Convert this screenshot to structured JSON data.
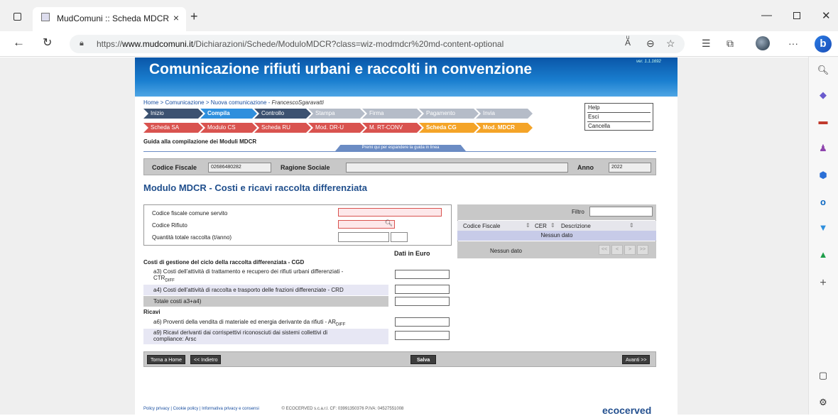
{
  "browser": {
    "tab_title": "MudComuni :: Scheda MDCR",
    "url_prefix": "https://",
    "url_domain": "www.mudcomuni.it",
    "url_path": "/Dichiarazioni/Schede/ModuloMDCR?class=wiz-modmdcr%20md-content-optional"
  },
  "header": {
    "title": "Comunicazione rifiuti urbani e raccolti in convenzione",
    "version": "ver. 1.1.1692"
  },
  "breadcrumb": {
    "path": "Home > Comunicazione > Nuova comunicazione - ",
    "user": "FrancescoSgaravatti"
  },
  "wizard_steps": [
    "Inizio",
    "Compila",
    "Controllo",
    "Stampa",
    "Firma",
    "Pagamento",
    "Invia"
  ],
  "schede": [
    "Scheda SA",
    "Modulo CS",
    "Scheda RU",
    "Mod. DR-U",
    "M. RT-CONV",
    "Scheda CG",
    "Mod. MDCR"
  ],
  "help_menu": [
    "Help",
    "Esci",
    "Cancella"
  ],
  "guide": {
    "title": "Guida alla compilazione dei Moduli MDCR",
    "expand_label": "Premi qui per espandere la guida in linea"
  },
  "info": {
    "cf_label": "Codice Fiscale",
    "cf_value": "02686480282",
    "rs_label": "Ragione Sociale",
    "rs_value": "",
    "anno_label": "Anno",
    "anno_value": "2022"
  },
  "module_title": "Modulo MDCR - Costi e ricavi raccolta differenziata",
  "form": {
    "cf_servito_label": "Codice fiscale comune servito",
    "codice_rifiuto_label": "Codice Rifiuto",
    "quantita_label": "Quantità totale raccolta (t/anno)"
  },
  "grid": {
    "filter_label": "Filtro",
    "columns": [
      "Codice Fiscale",
      "CER",
      "Descrizione"
    ],
    "no_data_row": "Nessun dato",
    "no_data_footer": "Nessun dato",
    "pager": [
      "<<",
      "<",
      ">",
      ">>"
    ]
  },
  "costs": {
    "dati_euro": "Dati in Euro",
    "section_cgd": "Costi di gestione del ciclo della raccolta differenziata - CGD",
    "a3_text": "a3) Costi dell'attività di trattamento e recupero dei rifiuti urbani differenziati -",
    "a3_text2": "CTR",
    "a3_sub": "DIFF",
    "a4_text": "a4) Costi dell'attività di raccolta e trasporto delle frazioni differenziate - CRD",
    "totale_text": "Totale costi a3+a4)",
    "section_ricavi": "Ricavi",
    "a6_text": "a6) Proventi della vendita di materiale ed energia derivante da rifiuti - AR",
    "a6_sub": "DIFF",
    "a9_text": "a9) Ricavi derivanti dai corrispettivi riconosciuti dai sistemi collettivi di",
    "a9_text2": "compliance: Arsc"
  },
  "buttons": {
    "home": "Torna a Home",
    "back": "<< Indietro",
    "save": "Salva",
    "next": "Avanti >>"
  },
  "footer": {
    "links": "Policy privacy  |  Cookie policy  |  Informativa privacy e consensi",
    "company": "© ECOCERVED s.c.a.r.l.   CF: 03991350376  P.IVA: 04527551008",
    "logo": "ecocerved"
  }
}
